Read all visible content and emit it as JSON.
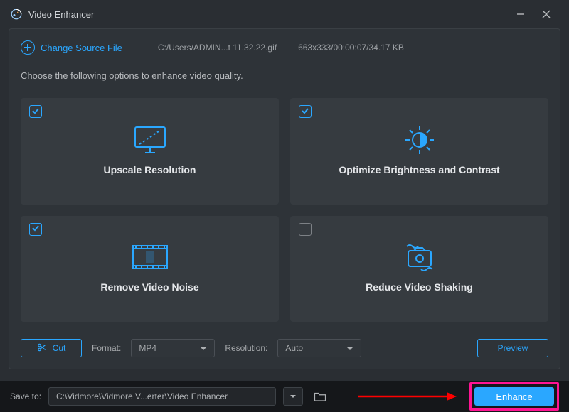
{
  "window": {
    "title": "Video Enhancer"
  },
  "source": {
    "link_label": "Change Source File",
    "path": "C:/Users/ADMIN...t 11.32.22.gif",
    "info": "663x333/00:00:07/34.17 KB"
  },
  "instructions": "Choose the following options to enhance video quality.",
  "cards": [
    {
      "id": "upscale",
      "label": "Upscale Resolution",
      "checked": true
    },
    {
      "id": "brightness",
      "label": "Optimize Brightness and Contrast",
      "checked": true
    },
    {
      "id": "noise",
      "label": "Remove Video Noise",
      "checked": true
    },
    {
      "id": "shaking",
      "label": "Reduce Video Shaking",
      "checked": false
    }
  ],
  "toolbar": {
    "cut_label": "Cut",
    "format_label": "Format:",
    "format_value": "MP4",
    "resolution_label": "Resolution:",
    "resolution_value": "Auto",
    "preview_label": "Preview"
  },
  "save": {
    "label": "Save to:",
    "path": "C:\\Vidmore\\Vidmore V...erter\\Video Enhancer",
    "enhance_label": "Enhance"
  }
}
